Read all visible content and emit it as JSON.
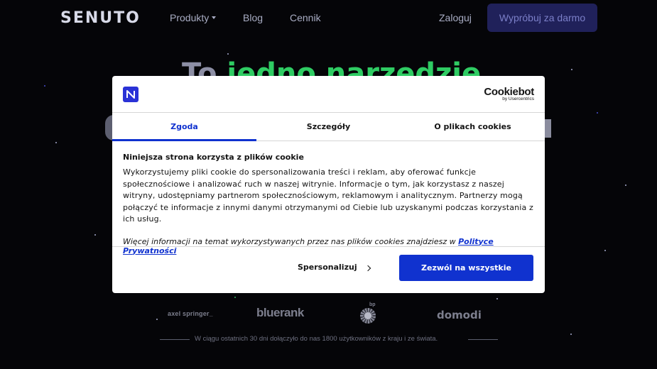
{
  "nav": {
    "logo": "SENUTO",
    "produkty": "Produkty",
    "blog": "Blog",
    "cennik": "Cennik",
    "zaloguj": "Zaloguj",
    "try": "Wypróbuj za darmo"
  },
  "brands": {
    "axel": "axel springer_",
    "bluerank": "bluerank",
    "bp": "bp",
    "domodi": "domodi"
  },
  "footnote": "W ciągu ostatnich 30 dni dołączyło do nas 1800 użytkowników z kraju i ze świata.",
  "consent": {
    "provider_main": "Cookiebot",
    "provider_sub": "by Usercentrics",
    "tabs": [
      "Zgoda",
      "Szczegóły",
      "O plikach cookies"
    ],
    "title": "Niniejsza strona korzysta z plików cookie",
    "text": "Wykorzystujemy pliki cookie do spersonalizowania treści i reklam, aby oferować funkcje społecznościowe i analizować ruch w naszej witrynie. Informacje o tym, jak korzystasz z naszej witryny, udostępniamy partnerom społecznościowym, reklamowym i analitycznym. Partnerzy mogą połączyć te informacje z innymi danymi otrzymanymi od Ciebie lub uzyskanymi podczas korzystania z ich usług.",
    "more_prefix": "Więcej informacji na temat wykorzystywanych przez nas plików cookies znajdziesz w",
    "more_link": "Polityce Prywatności",
    "personalize": "Spersonalizuj",
    "allow_all": "Zezwól na wszystkie"
  },
  "colors": {
    "accent": "#1032cf",
    "background": "#050508",
    "try_button": "#20215a"
  }
}
